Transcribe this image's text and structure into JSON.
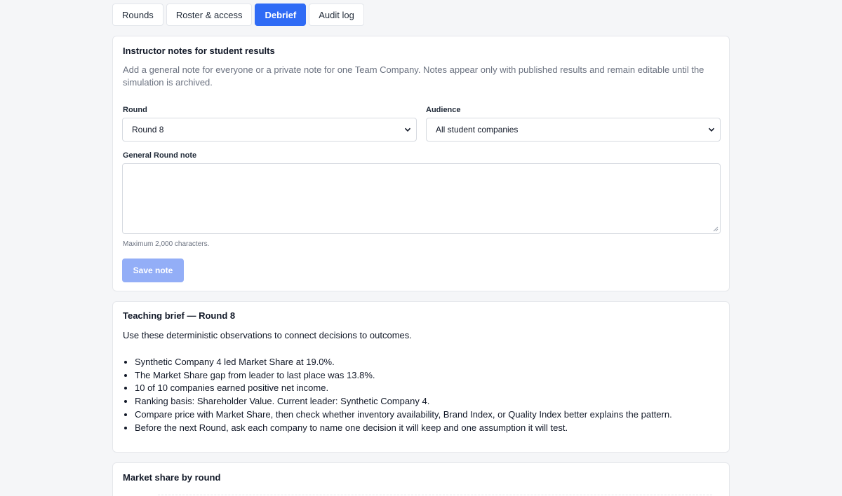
{
  "tabs": [
    {
      "label": "Rounds",
      "active": false
    },
    {
      "label": "Roster & access",
      "active": false
    },
    {
      "label": "Debrief",
      "active": true
    },
    {
      "label": "Audit log",
      "active": false
    }
  ],
  "notes": {
    "title": "Instructor notes for student results",
    "description": "Add a general note for everyone or a private note for one Team Company. Notes appear only with published results and remain editable until the simulation is archived.",
    "round_label": "Round",
    "round_value": "Round 8",
    "audience_label": "Audience",
    "audience_value": "All student companies",
    "note_label": "General Round note",
    "note_value": "",
    "hint": "Maximum 2,000 characters.",
    "save_label": "Save note"
  },
  "brief": {
    "title": "Teaching brief — Round 8",
    "intro": "Use these deterministic observations to connect decisions to outcomes.",
    "items": [
      "Synthetic Company 4 led Market Share at 19.0%.",
      "The Market Share gap from leader to last place was 13.8%.",
      "10 of 10 companies earned positive net income.",
      "Ranking basis: Shareholder Value. Current leader: Synthetic Company 4.",
      "Compare price with Market Share, then check whether inventory availability, Brand Index, or Quality Index better explains the pattern.",
      "Before the next Round, ask each company to name one decision it will keep and one assumption it will test."
    ]
  },
  "market": {
    "title": "Market share by round"
  },
  "colors": {
    "accent": "#2f6bf5",
    "accent_disabled": "#93aef7",
    "page_bg": "#f5f6f8"
  }
}
